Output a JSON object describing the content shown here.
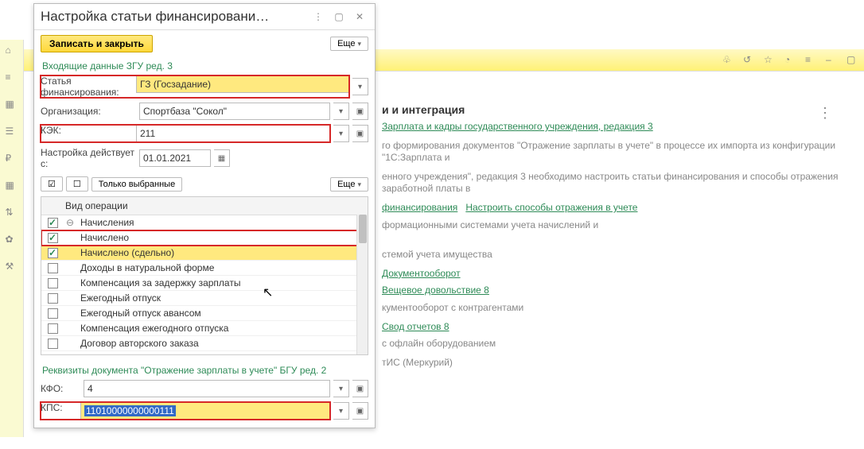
{
  "dialog": {
    "title": "Настройка статьи финансировани…",
    "save_close": "Записать и закрыть",
    "more": "Еще",
    "section1": "Входящие данные ЗГУ ред. 3",
    "fields": {
      "financing_article": {
        "label": "Статья финансирования:",
        "value": "ГЗ (Госзадание)"
      },
      "organization": {
        "label": "Организация:",
        "value": "Спортбаза \"Сокол\""
      },
      "kek": {
        "label": "КЭК:",
        "value": "211"
      },
      "valid_from": {
        "label": "Настройка действует с:",
        "value": "01.01.2021"
      }
    },
    "only_selected": "Только выбранные",
    "ops_header": "Вид операции",
    "operations": [
      {
        "checked": true,
        "label": "Начисления",
        "level": 0,
        "hl": false,
        "group": true
      },
      {
        "checked": true,
        "label": "Начислено",
        "level": 1,
        "hl": false,
        "red": true
      },
      {
        "checked": true,
        "label": "Начислено (сдельно)",
        "level": 1,
        "hl": true
      },
      {
        "checked": false,
        "label": "Доходы в натуральной форме",
        "level": 1,
        "hl": false
      },
      {
        "checked": false,
        "label": "Компенсация за задержку зарплаты",
        "level": 1,
        "hl": false
      },
      {
        "checked": false,
        "label": "Ежегодный отпуск",
        "level": 1,
        "hl": false
      },
      {
        "checked": false,
        "label": "Ежегодный отпуск авансом",
        "level": 1,
        "hl": false
      },
      {
        "checked": false,
        "label": "Компенсация ежегодного отпуска",
        "level": 1,
        "hl": false
      },
      {
        "checked": false,
        "label": "Договор авторского заказа",
        "level": 1,
        "hl": false
      }
    ],
    "section2": "Реквизиты документа \"Отражение зарплаты в учете\" БГУ ред. 2",
    "kfo": {
      "label": "КФО:",
      "value": "4"
    },
    "kps": {
      "label": "КПС:",
      "value": "11010000000000111"
    }
  },
  "background": {
    "heading_fragment": "и и интеграция",
    "line1a": "Зарплата и кадры государственного учреждения, редакция 3",
    "line2": "го формирования документов \"Отражение зарплаты в учете\" в процессе их импорта из конфигурации \"1С:Зарплата и",
    "line3": "енного учреждения\", редакция 3 необходимо настроить  статьи финансирования и способы отражения заработной платы в",
    "link_row": {
      "a": "финансирования",
      "b": "Настроить способы отражения в учете"
    },
    "line4": "формационными системами учета начислений и",
    "line5": "стемой учета имущества",
    "line6": "Документооборот",
    "line7": "Вещевое довольствие 8",
    "line8": "кументооборот с контрагентами",
    "line9": "Свод отчетов 8",
    "line10": "с офлайн оборудованием",
    "line11": "тИС (Меркурий)"
  }
}
